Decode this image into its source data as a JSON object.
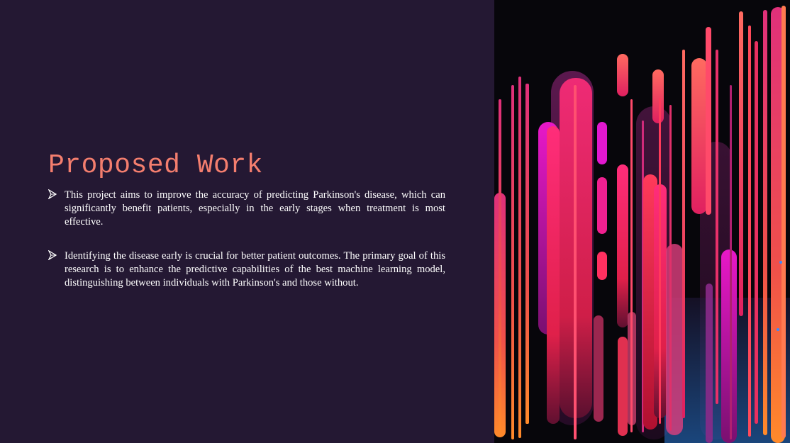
{
  "slide": {
    "title": "Proposed Work",
    "bullets": [
      {
        "text": "This project aims to improve the accuracy of predicting Parkinson's disease, which can significantly benefit patients, especially in the early stages when treatment is most effective."
      },
      {
        "text": "Identifying the disease early is crucial for better patient outcomes. The primary goal of this research is to enhance the predictive capabilities of the best machine learning model, distinguishing between individuals with Parkinson's and those without."
      }
    ],
    "bullet_icon": "arrowhead-bullet-icon"
  },
  "colors": {
    "background": "#241833",
    "title": "#f47e6e",
    "body_text": "#ffffff",
    "art_background": "#07060b"
  },
  "artwork": {
    "description_icon": "abstract-neon-bars-image"
  }
}
